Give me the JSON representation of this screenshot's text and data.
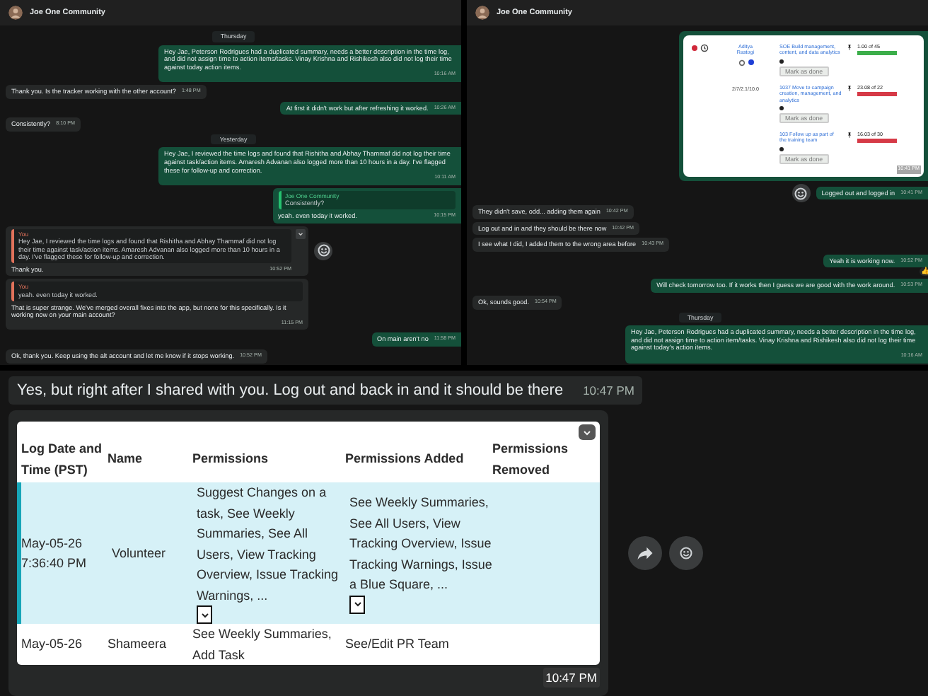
{
  "panels": [
    {
      "header": {
        "title": "Joe One Community"
      },
      "messages": [
        {
          "kind": "date",
          "text": "Thursday"
        },
        {
          "kind": "message",
          "outgoing": true,
          "text": "Hey Jae, Peterson Rodrigues had a duplicated summary, needs a better description in the time log, and did not assign time to action items/tasks. Vinay Krishna and Rishikesh also did not log their time against today action items.",
          "time": "10:16 AM"
        },
        {
          "kind": "message",
          "outgoing": false,
          "text": "Thank you. Is the tracker working with the other account?",
          "time": "1:48 PM"
        },
        {
          "kind": "message",
          "outgoing": true,
          "text": "At first it didn't work but after refreshing it worked.",
          "time": "10:26 AM"
        },
        {
          "kind": "message",
          "outgoing": false,
          "text": "Consistently?",
          "time": "8:10 PM"
        },
        {
          "kind": "date",
          "text": "Yesterday"
        },
        {
          "kind": "message",
          "outgoing": true,
          "text": "Hey Jae, I reviewed the time logs and found that Rishitha and Abhay Thammaf did not log their time against task/action items. Amaresh Advanan also logged more than 10 hours in a day. I've flagged these for follow-up and correction.",
          "time": "10:11 AM"
        },
        {
          "kind": "message",
          "outgoing": true,
          "quote": {
            "author": "Joe One Community",
            "text": "Consistently?"
          },
          "text": "yeah. even today it worked.",
          "time": "10:15 PM"
        },
        {
          "kind": "message",
          "outgoing": false,
          "hover_actions": [
            {
              "kind": "react"
            }
          ],
          "quote": {
            "author": "You",
            "text": "Hey Jae, I reviewed the time logs and found that Rishitha and Abhay Thammaf did not log their time against task/action items. Amaresh Advanan also logged more than 10 hours in a day. I've flagged these for follow-up and correction."
          },
          "text": "Thank you.",
          "time": "10:52 PM"
        },
        {
          "kind": "message",
          "outgoing": false,
          "quote": {
            "author": "You",
            "text": "yeah. even today it worked."
          },
          "text": "That is super strange. We've merged overall fixes into the app, but none for this specifically. Is it working now on your main account?",
          "time": "11:15 PM"
        },
        {
          "kind": "message",
          "outgoing": true,
          "text": "On main aren't no",
          "time": "11:58 PM"
        },
        {
          "kind": "message",
          "outgoing": false,
          "text": "Ok, thank you. Keep using the alt account and let me know if it stops working.",
          "time": "10:52 PM"
        }
      ]
    },
    {
      "header": {
        "title": "Joe One Community"
      },
      "messages": [
        {
          "kind": "task_card",
          "time": "10:41 PM",
          "person": {
            "name": "Aditya Rastogi",
            "dates": "2/7/2.1/10.0"
          },
          "tasks": [
            {
              "title": "SOE Build management, content, and data analytics",
              "hours": "1.00 of 45",
              "level": 1,
              "color": "#3cae4a",
              "button": "Mark as done"
            },
            {
              "title": "1037 Move to campaign creation, management, and analytics",
              "hours": "23.08 of 22",
              "level": 1,
              "color": "#d63a47",
              "button": "Mark as done"
            },
            {
              "title": "103 Follow up as part of the training team",
              "hours": "16.03 of 30",
              "level": 1,
              "color": "#d63a47",
              "button": "Mark as done"
            }
          ]
        },
        {
          "kind": "message",
          "outgoing": true,
          "hover_actions": [
            {
              "kind": "react"
            }
          ],
          "text": "Logged out and logged in",
          "time": "10:41 PM"
        },
        {
          "kind": "message",
          "outgoing": false,
          "text": "They didn't save, odd... adding them again",
          "time": "10:42 PM"
        },
        {
          "kind": "message",
          "outgoing": false,
          "text": "Log out and in and they should be there now",
          "time": "10:42 PM"
        },
        {
          "kind": "message",
          "outgoing": false,
          "text": "I see what I did, I added them to the wrong area before",
          "time": "10:43 PM"
        },
        {
          "kind": "message",
          "outgoing": true,
          "text": "Yeah it is working now.",
          "time": "10:52 PM",
          "reaction": "👍"
        },
        {
          "kind": "message",
          "outgoing": true,
          "text": "Will check tomorrow too. If it works then I guess we are good with the work around.",
          "time": "10:53 PM"
        },
        {
          "kind": "message",
          "outgoing": false,
          "text": "Ok, sounds good.",
          "time": "10:54 PM"
        },
        {
          "kind": "date",
          "text": "Thursday"
        },
        {
          "kind": "message",
          "outgoing": true,
          "text": "Hey Jae, Peterson Rodrigues had a duplicated summary, needs a better description in the time log, and did not assign time to action item/tasks. Vinay Krishna and Rishikesh also did not log their time against today's action items.",
          "time": "10:16 AM"
        }
      ]
    },
    {
      "messages": [
        {
          "kind": "message",
          "outgoing": false,
          "text": "Yes, but right after I shared with you. Log out and back in and it should be there",
          "time": "10:47 PM"
        },
        {
          "kind": "table_image",
          "time": "10:47 PM",
          "hover_actions": [
            {
              "kind": "forward"
            },
            {
              "kind": "react"
            }
          ],
          "columns": [
            "Log Date and Time (PST)",
            "Name",
            "Permissions",
            "Permissions Added",
            "Permissions Removed"
          ],
          "rows": [
            {
              "selected": true,
              "cells": [
                "May-05-26 7:36:40 PM",
                "Volunteer",
                "Suggest Changes on a task, See Weekly Summaries, See All Users, View Tracking Overview, Issue Tracking Warnings, ...",
                "See Weekly Summaries, See All Users, View Tracking Overview, Issue Tracking Warnings, Issue a Blue Square, ..."
              ],
              "expandable": [
                false,
                false,
                true,
                true
              ]
            },
            {
              "selected": false,
              "cells": [
                "May-05-26",
                "Shameera",
                "See Weekly Summaries, Add Task",
                "See/Edit PR Team"
              ],
              "expandable": [
                false,
                false,
                false,
                false
              ]
            }
          ]
        }
      ]
    }
  ]
}
